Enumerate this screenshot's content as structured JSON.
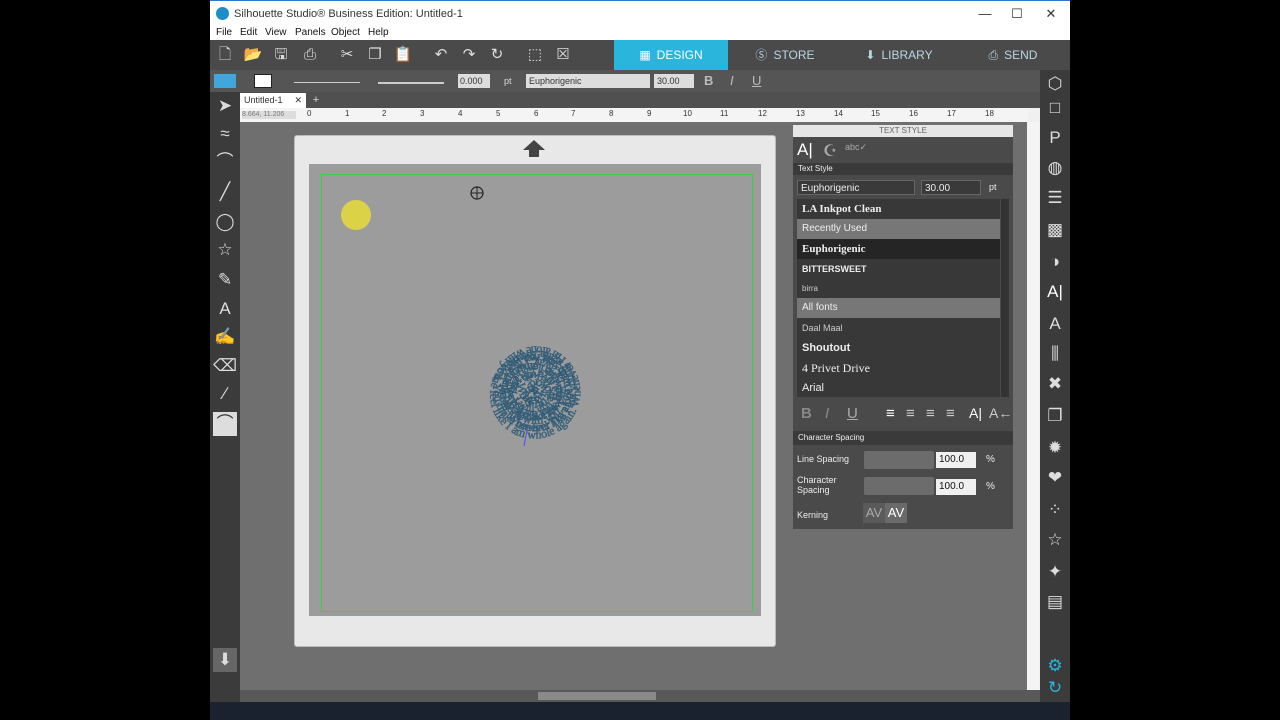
{
  "window": {
    "title": "Silhouette Studio® Business Edition: Untitled-1",
    "minimize": "—",
    "maximize": "☐",
    "close": "✕"
  },
  "menu": [
    "File",
    "Edit",
    "View",
    "Panels",
    "Object",
    "Help"
  ],
  "top_tabs": [
    {
      "label": "DESIGN",
      "icon": "grid-icon"
    },
    {
      "label": "STORE",
      "icon": "silhouette-s-icon"
    },
    {
      "label": "LIBRARY",
      "icon": "library-icon"
    },
    {
      "label": "SEND",
      "icon": "send-icon"
    }
  ],
  "line_width": {
    "value": "0.000",
    "unit": "pt"
  },
  "font_toolbar": {
    "font": "Euphorigenic",
    "size": "30.00"
  },
  "doc_tab": "Untitled-1",
  "coords": "8.664, 11.206",
  "ruler_numbers": [
    "0",
    "1",
    "2",
    "3",
    "4",
    "5",
    "6",
    "7",
    "8",
    "9",
    "10",
    "11",
    "12",
    "13",
    "14",
    "15",
    "16",
    "17",
    "18"
  ],
  "spiral_text": "Whenever I'm alone with you, You make me feel like I am home again. Whenever I'm alone with you, You make me feel like I am whole again. Whenever I'm alone with you, You make me feel like I am young again. Whenever I'm alone with you, You make me feel like I am fun again. However far away, I will always love you. However long I stay, I will always love you. Whatever words I say, I will always love you. I will always love you. Whenever I'm alone with you, You make me feel like I am free again. Whenever I'm alone with you, You make me feel like I am clean again.",
  "text_style_panel": {
    "title": "TEXT STYLE",
    "section_label": "Text Style",
    "font": "Euphorigenic",
    "size": "30.00",
    "unit": "pt",
    "fonts": [
      {
        "label": "LA Inkpot Clean",
        "kind": "item"
      },
      {
        "label": "Recently Used",
        "kind": "header"
      },
      {
        "label": "Euphorigenic",
        "kind": "selected"
      },
      {
        "label": "BITTERSWEET",
        "kind": "item"
      },
      {
        "label": "birra",
        "kind": "item"
      },
      {
        "label": "All fonts",
        "kind": "header"
      },
      {
        "label": "Daal Maal",
        "kind": "item"
      },
      {
        "label": "Shoutout",
        "kind": "item"
      },
      {
        "label": "4 Privet Drive",
        "kind": "item"
      },
      {
        "label": "Arial",
        "kind": "item"
      }
    ],
    "character_spacing_header": "Character Spacing",
    "line_spacing_label": "Line Spacing",
    "line_spacing_value": "100.0",
    "char_spacing_label": "Character Spacing",
    "char_spacing_value": "100.0",
    "percent": "%",
    "kerning_label": "Kerning",
    "kerning_off": "AV",
    "kerning_on": "AV"
  },
  "colors": {
    "accent": "#29b5dc",
    "spiral_text": "#3d6d8a",
    "cut_line": "#3ccc4a",
    "cursor_highlight": "#e8dc3a"
  }
}
